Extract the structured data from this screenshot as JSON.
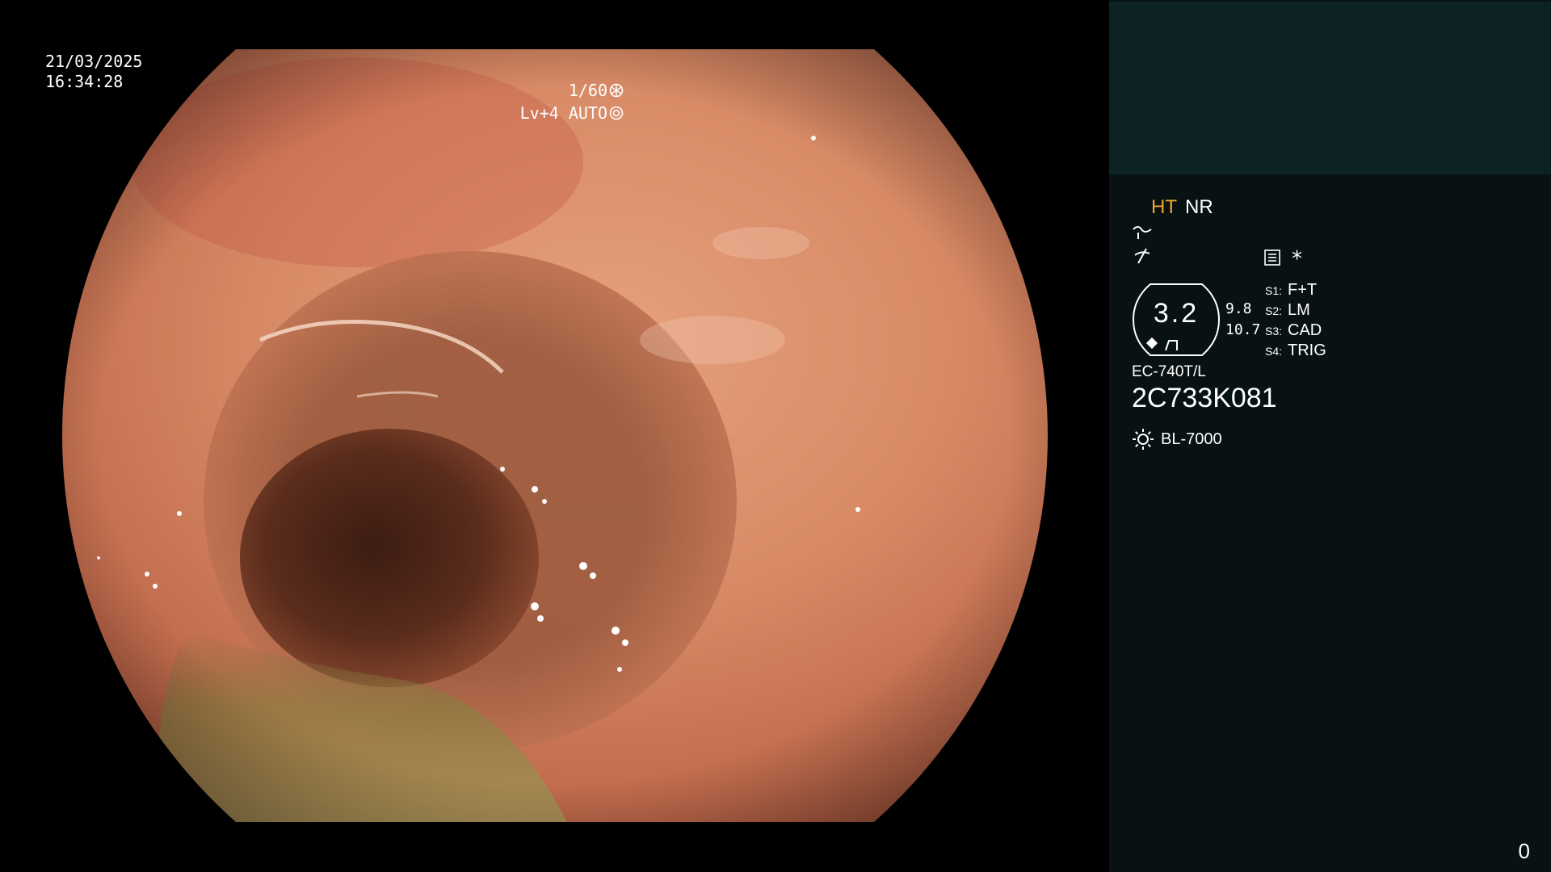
{
  "video": {
    "date": "21/03/2025",
    "time": "16:34:28",
    "shutter": "1/60",
    "shutter_icon": "aperture-icon",
    "level": "Lv+4 AUTO",
    "level_icon": "iris-icon",
    "scene_description_icon": "endoscopic-lumen-image"
  },
  "panel": {
    "mode_ht": "HT",
    "mode_nr": "NR",
    "mode_ht_color": "#f0a531",
    "icon_curve": "curve-icon",
    "icon_slash": "structure-enhancement-icon",
    "icon_memo": "memo-icon",
    "asterisk": "*",
    "zoom": "3.2",
    "zoom_side_top": "9.8",
    "zoom_side_bottom": "10.7",
    "s_items": [
      {
        "key": "S1:",
        "value": "F+T"
      },
      {
        "key": "S2:",
        "value": "LM"
      },
      {
        "key": "S3:",
        "value": "CAD"
      },
      {
        "key": "S4:",
        "value": "TRIG"
      }
    ],
    "scope_model": "EC-740T/L",
    "scope_serial": "2C733K081",
    "light_icon": "light-source-icon",
    "light_source": "BL-7000",
    "counter": "0",
    "colors": {
      "panel_bg": "#081212",
      "thumb_bg": "#0d2224"
    }
  }
}
